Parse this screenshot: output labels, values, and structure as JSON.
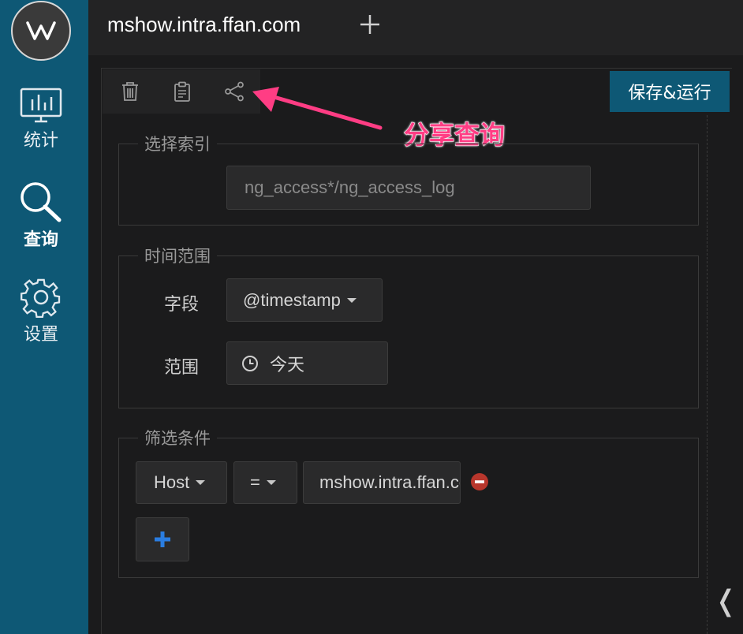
{
  "sidebar": {
    "logo_icon": "w-logo-icon",
    "items": [
      {
        "label": "统计",
        "icon": "chart-icon",
        "active": false
      },
      {
        "label": "查询",
        "icon": "search-icon",
        "active": true
      },
      {
        "label": "设置",
        "icon": "gear-icon",
        "active": false
      }
    ]
  },
  "tabbar": {
    "title": "mshow.intra.ffan.com",
    "add_icon": "plus-icon"
  },
  "toolbar": {
    "icons": [
      "trash-icon",
      "clipboard-icon",
      "share-icon"
    ],
    "run_label": "保存&运行"
  },
  "annotation": {
    "text": "分享查询"
  },
  "index_section": {
    "legend": "选择索引",
    "index_value": "ng_access*/ng_access_log"
  },
  "time_section": {
    "legend": "时间范围",
    "field_label": "字段",
    "field_value": "@timestamp",
    "range_label": "范围",
    "range_value": "今天"
  },
  "filter_section": {
    "legend": "筛选条件",
    "field_value": "Host",
    "operator_value": "=",
    "input_value": "mshow.intra.ffan.com",
    "add_icon": "plus-icon",
    "remove_icon": "minus-circle-icon"
  },
  "colors": {
    "sidebar_bg": "#0e5875",
    "accent": "#0e5875",
    "annotation": "#ff3d84",
    "remove": "#c0392b",
    "add": "#2a7de1"
  }
}
